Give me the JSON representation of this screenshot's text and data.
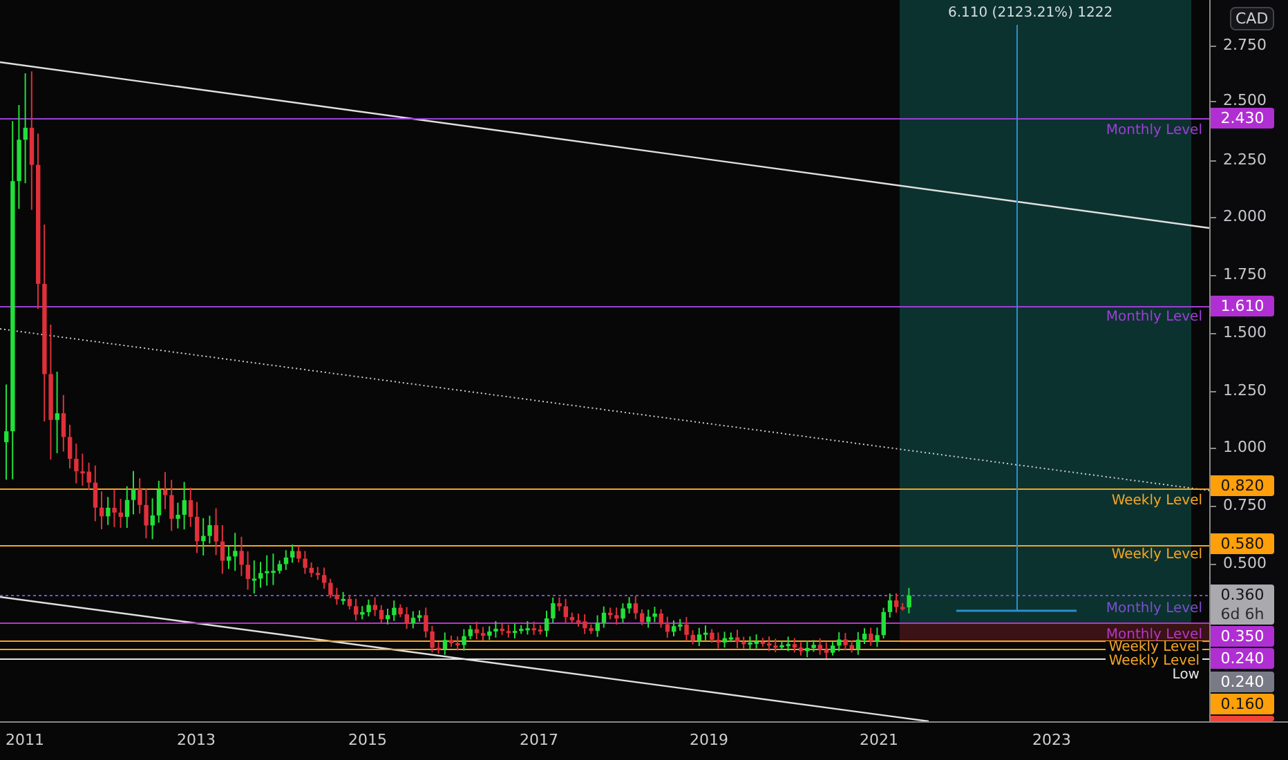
{
  "measurement": {
    "text": "6.110 (2123.21%) 1222"
  },
  "levels": [
    {
      "label": "Monthly Level",
      "color": "#9c3fd6",
      "kind": "solid"
    },
    {
      "label": "Monthly Level",
      "color": "#9c3fd6",
      "kind": "solid"
    },
    {
      "label": "Weekly Level",
      "color": "#f5a623",
      "kind": "solid"
    },
    {
      "label": "Weekly Level",
      "color": "#f5a623",
      "kind": "solid"
    },
    {
      "label": "Monthly Level",
      "color": "#7a4fd0",
      "kind": "dotted"
    },
    {
      "label": "Monthly Level",
      "color": "#b536c8",
      "kind": "solid"
    },
    {
      "label": "Weekly Level",
      "color": "#f5a623",
      "kind": "solid"
    },
    {
      "label": "Weekly Level",
      "color": "#f5a623",
      "kind": "solid"
    },
    {
      "label": "Low",
      "color": "#e6e6e6",
      "kind": "solid"
    }
  ],
  "price_axis": {
    "currency": "CAD",
    "ticks": [
      "2.750",
      "2.500",
      "2.250",
      "2.000",
      "1.750",
      "1.500",
      "1.250",
      "1.000",
      "0.750",
      "0.500"
    ]
  },
  "price_labels": [
    {
      "text": "2.430",
      "color": "#b02fd2"
    },
    {
      "text": "1.610",
      "color": "#b02fd2"
    },
    {
      "text": "0.820",
      "color": "#ff9f0a"
    },
    {
      "text": "0.580",
      "color": "#ff9f0a"
    },
    {
      "text": "0.360",
      "sub": "6d 6h",
      "color": "#a9a9ae"
    },
    {
      "text": "0.350",
      "color": "#b02fd2"
    },
    {
      "text": "0.240",
      "color": "#b02fd2"
    },
    {
      "text": "0.240",
      "color": "#787b86"
    },
    {
      "text": "0.160",
      "color": "#ff9f0a"
    }
  ],
  "time_axis": {
    "ticks": [
      "2011",
      "2013",
      "2015",
      "2017",
      "2019",
      "2021",
      "2023"
    ]
  }
}
